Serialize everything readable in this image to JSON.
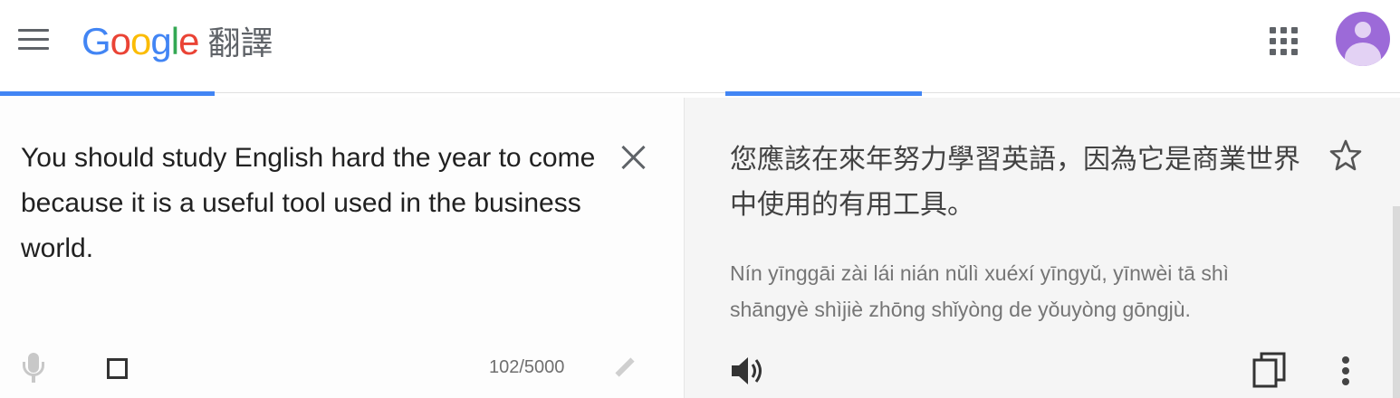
{
  "header": {
    "logo_letters": [
      "G",
      "o",
      "o",
      "g",
      "l",
      "e"
    ],
    "product_name": "翻譯",
    "menu_icon": "hamburger-menu-icon",
    "apps_icon": "apps-grid-icon",
    "avatar_icon": "account-avatar-icon",
    "avatar_color": "#9c6ad8"
  },
  "tabs": {
    "active_indicator_color": "#4285f4"
  },
  "source": {
    "text": "You should study English hard the year to come because it is a useful tool used in the business world.",
    "char_count": "102/5000",
    "clear_icon": "close-icon",
    "mic_icon": "microphone-icon",
    "keyboard_icon": "keyboard-icon",
    "pencil_icon": "pencil-icon"
  },
  "target": {
    "translation": "您應該在來年努力學習英語，因為它是商業世界中使用的有用工具。",
    "romanization": "Nín yīnggāi zài lái nián nǔlì xuéxí yīngyǔ, yīnwèi tā shì shāngyè shìjiè zhōng shǐyòng de yǒuyòng gōngjù.",
    "star_icon": "star-outline-icon",
    "speaker_icon": "speaker-icon",
    "copy_icon": "copy-icon",
    "more_icon": "more-vertical-icon"
  }
}
